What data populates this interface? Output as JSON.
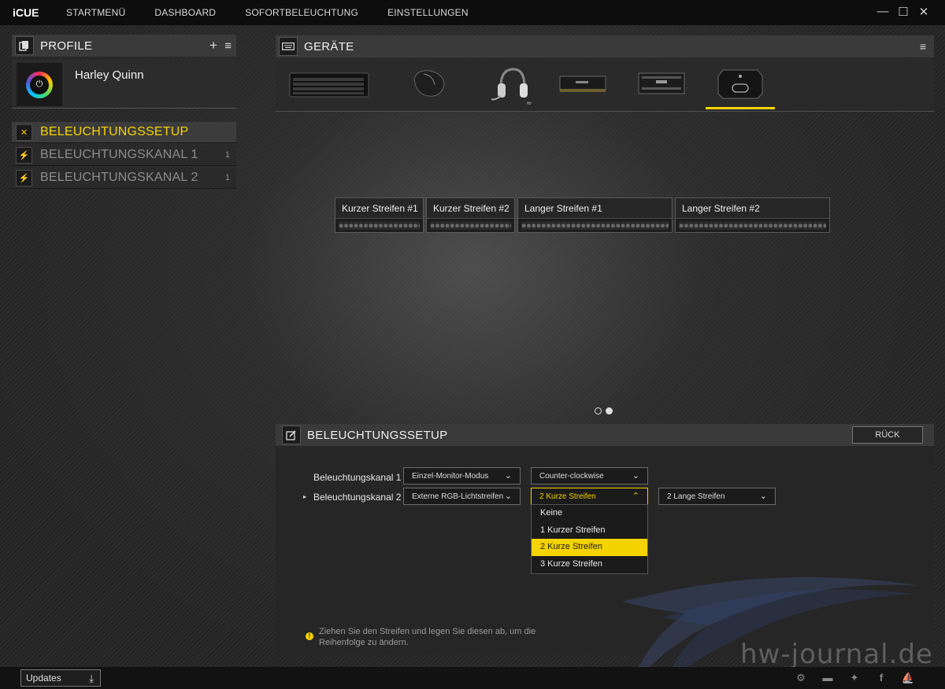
{
  "app": {
    "logo": "iCUE",
    "nav": [
      "STARTMENÜ",
      "DASHBOARD",
      "SOFORTBELEUCHTUNG",
      "EINSTELLUNGEN"
    ]
  },
  "window_controls": [
    "—",
    "☐",
    "✕"
  ],
  "profiles": {
    "title": "PROFILE",
    "add_icon": "+",
    "menu_icon": "≡",
    "active_profile": "Harley Quinn",
    "items": [
      {
        "label": "BELEUCHTUNGSSETUP",
        "count": "",
        "icon": "wrench-icon",
        "active": true
      },
      {
        "label": "BELEUCHTUNGSKANAL 1",
        "count": "1",
        "icon": "bolt-icon",
        "active": false
      },
      {
        "label": "BELEUCHTUNGSKANAL 2",
        "count": "1",
        "icon": "bolt-icon",
        "active": false
      }
    ]
  },
  "devices": {
    "title": "GERÄTE",
    "list": [
      "keyboard-icon",
      "mouse-icon",
      "headset-icon",
      "memory-icon",
      "memory2-icon",
      "lighting-node-icon"
    ],
    "selected_index": 5
  },
  "strips": [
    {
      "label": "Kurzer Streifen #1"
    },
    {
      "label": "Kurzer Streifen #2"
    },
    {
      "label": "Langer Streifen #1"
    },
    {
      "label": "Langer Streifen #2"
    }
  ],
  "setup": {
    "title": "BELEUCHTUNGSSETUP",
    "back_label": "RÜCK",
    "channel1": {
      "label": "Beleuchtungskanal 1",
      "mode": "Einzel-Monitor-Modus",
      "direction": "Counter-clockwise"
    },
    "channel2": {
      "label": "Beleuchtungskanal 2",
      "mode": "Externe RGB-Lichtstreifen",
      "short_strips": "2 Kurze Streifen",
      "long_strips": "2 Lange Streifen"
    },
    "dropdown_options": [
      "Keine",
      "1 Kurzer Streifen",
      "2 Kurze Streifen",
      "3 Kurze Streifen"
    ],
    "dropdown_selected": "2 Kurze Streifen",
    "hint": "Ziehen Sie den Streifen und legen Sie diesen ab, um die Reihenfolge zu ändern."
  },
  "footer": {
    "updates_label": "Updates",
    "icons": [
      "community-icon",
      "chat-icon",
      "twitter-icon",
      "facebook-icon",
      "corsair-icon"
    ]
  },
  "watermark": "hw-journal.de",
  "colors": {
    "accent": "#f5d300",
    "panel": "#2a2a2a",
    "header": "#3a3a3a"
  }
}
